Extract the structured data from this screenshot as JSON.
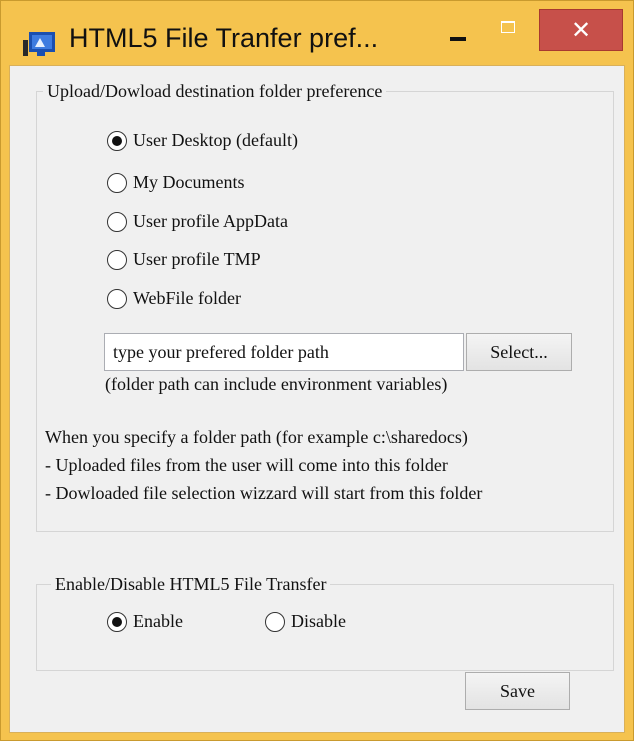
{
  "window": {
    "title": "HTML5 File Tranfer pref...",
    "close_glyph": "✕",
    "icons": {
      "app": "app-window-icon",
      "minimize": "minimize-icon",
      "maximize": "maximize-icon",
      "close": "close-icon"
    },
    "colors": {
      "frame": "#f5c34e",
      "close_button": "#c7504a",
      "client": "#f0f0f0"
    }
  },
  "destination_group": {
    "legend": "Upload/Dowload destination folder preference",
    "options": [
      {
        "label": "User Desktop (default)",
        "checked": true
      },
      {
        "label": "My Documents",
        "checked": false
      },
      {
        "label": "User profile AppData",
        "checked": false
      },
      {
        "label": "User profile TMP",
        "checked": false
      },
      {
        "label": "WebFile folder",
        "checked": false
      }
    ],
    "path_input": {
      "value": "type your prefered folder path",
      "placeholder": ""
    },
    "select_button": "Select...",
    "path_hint": "(folder path can include environment variables)",
    "info_lines": [
      "When you specify a folder path (for example c:\\sharedocs)",
      "- Uploaded files from the user will come into this folder",
      "- Dowloaded file selection wizzard will start from this folder"
    ]
  },
  "transfer_group": {
    "legend": "Enable/Disable HTML5 File Transfer",
    "options": [
      {
        "label": "Enable",
        "checked": true
      },
      {
        "label": "Disable",
        "checked": false
      }
    ]
  },
  "save_button": "Save"
}
